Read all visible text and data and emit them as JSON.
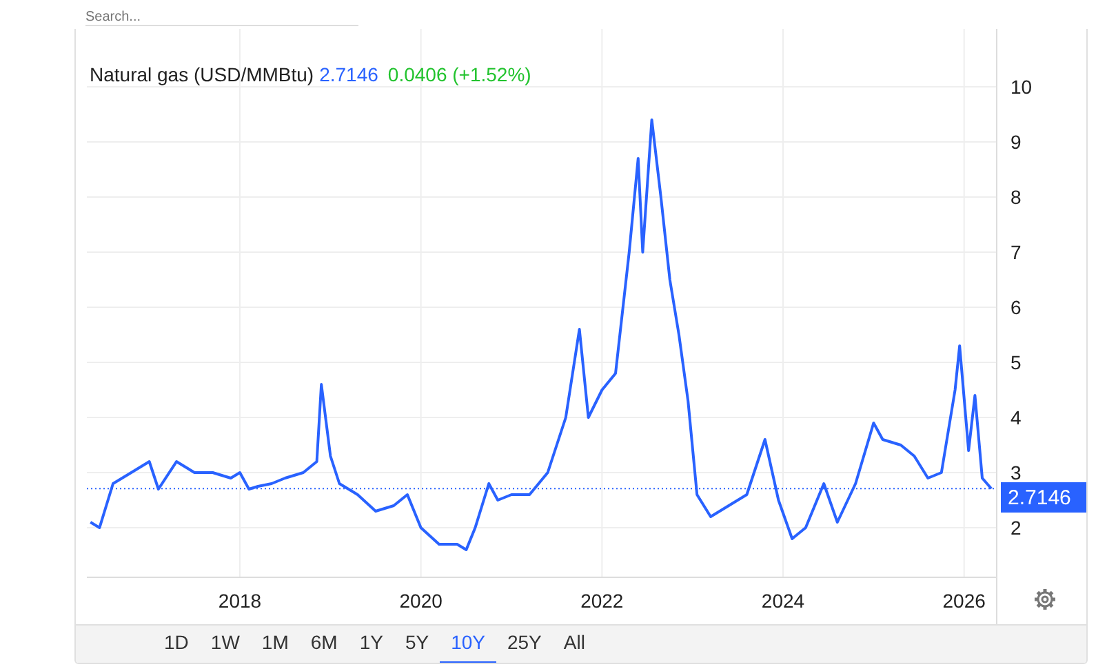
{
  "search": {
    "placeholder": "Search..."
  },
  "legend": {
    "title": "Natural gas (USD/MMBtu)",
    "price": "2.7146",
    "change": "0.0406 (+1.52%)"
  },
  "price_label": "2.7146",
  "chart_data": {
    "type": "line",
    "xlim": [
      2016.31,
      2026.36
    ],
    "ylim": [
      1.1,
      11.05
    ],
    "grid": true,
    "ref_lines": [
      {
        "axis": "y",
        "value": 2.71
      }
    ],
    "xticks": [
      2018,
      2020,
      2022,
      2024,
      2026
    ],
    "yticks": [
      2,
      3,
      4,
      5,
      6,
      7,
      8,
      9,
      10
    ],
    "x": [
      2016.35,
      2016.45,
      2016.6,
      2016.8,
      2017.0,
      2017.1,
      2017.3,
      2017.4,
      2017.5,
      2017.7,
      2017.9,
      2018.0,
      2018.1,
      2018.2,
      2018.35,
      2018.5,
      2018.7,
      2018.85,
      2018.9,
      2019.0,
      2019.1,
      2019.3,
      2019.5,
      2019.7,
      2019.85,
      2020.0,
      2020.2,
      2020.4,
      2020.5,
      2020.6,
      2020.75,
      2020.85,
      2021.0,
      2021.2,
      2021.4,
      2021.6,
      2021.75,
      2021.85,
      2022.0,
      2022.15,
      2022.3,
      2022.4,
      2022.45,
      2022.55,
      2022.65,
      2022.75,
      2022.85,
      2022.95,
      2023.05,
      2023.2,
      2023.4,
      2023.6,
      2023.8,
      2023.95,
      2024.1,
      2024.25,
      2024.45,
      2024.6,
      2024.8,
      2025.0,
      2025.1,
      2025.3,
      2025.45,
      2025.6,
      2025.75,
      2025.9,
      2025.95,
      2026.05,
      2026.12,
      2026.2,
      2026.3
    ],
    "series": [
      {
        "color": "#2962ff",
        "values": [
          2.1,
          2.0,
          2.8,
          3.0,
          3.2,
          2.7,
          3.2,
          3.1,
          3.0,
          3.0,
          2.9,
          3.0,
          2.7,
          2.75,
          2.8,
          2.9,
          3.0,
          3.2,
          4.6,
          3.3,
          2.8,
          2.6,
          2.3,
          2.4,
          2.6,
          2.0,
          1.7,
          1.7,
          1.6,
          2.0,
          2.8,
          2.5,
          2.6,
          2.6,
          3.0,
          4.0,
          5.6,
          4.0,
          4.5,
          4.8,
          7.0,
          8.7,
          7.0,
          9.4,
          8.0,
          6.5,
          5.5,
          4.3,
          2.6,
          2.2,
          2.4,
          2.6,
          3.6,
          2.5,
          1.8,
          2.0,
          2.8,
          2.1,
          2.8,
          3.9,
          3.6,
          3.5,
          3.3,
          2.9,
          3.0,
          4.5,
          5.3,
          3.4,
          4.4,
          2.9,
          2.71
        ]
      }
    ]
  },
  "ranges": [
    {
      "label": "1D",
      "selected": false
    },
    {
      "label": "1W",
      "selected": false
    },
    {
      "label": "1M",
      "selected": false
    },
    {
      "label": "6M",
      "selected": false
    },
    {
      "label": "1Y",
      "selected": false
    },
    {
      "label": "5Y",
      "selected": false
    },
    {
      "label": "10Y",
      "selected": true
    },
    {
      "label": "25Y",
      "selected": false
    },
    {
      "label": "All",
      "selected": false
    }
  ]
}
